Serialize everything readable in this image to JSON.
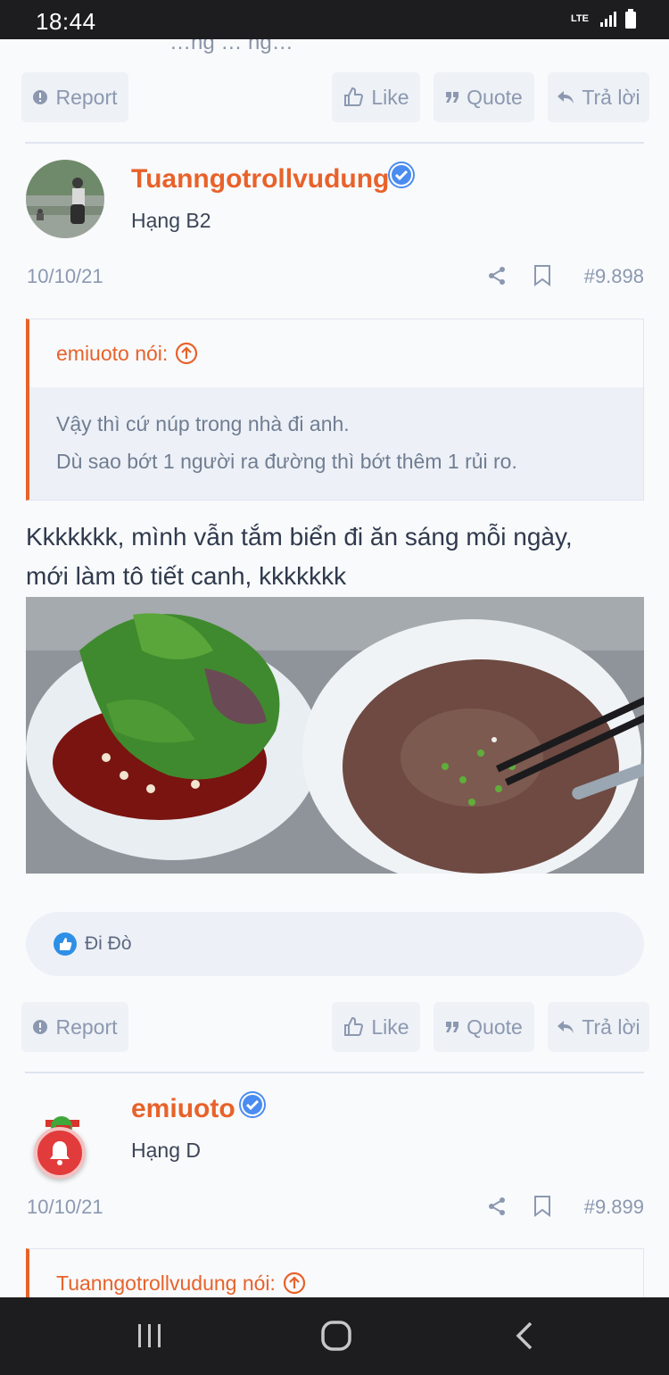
{
  "status_bar": {
    "time": "18:44",
    "network": "LTE"
  },
  "top_cut_text": "…ng … ng…",
  "action_labels": {
    "report": "Report",
    "like": "Like",
    "quote": "Quote",
    "reply": "Trả lời"
  },
  "posts": [
    {
      "username": "Tuanngotrollvudung",
      "rank": "Hạng B2",
      "date": "10/10/21",
      "post_number": "#9.898",
      "quote": {
        "author_label": "emiuoto nói:",
        "lines": [
          "Vậy thì cứ núp trong nhà đi anh.",
          "Dù sao bớt 1 người ra đường thì bớt thêm 1 rủi ro."
        ]
      },
      "text_lines": [
        "Kkkkkkk, mình vẫn tắm biển đi ăn sáng mỗi ngày,",
        "mới làm tô tiết canh, kkkkkkk"
      ],
      "reaction": {
        "icon": "like-icon",
        "user": "Đi Đò"
      }
    },
    {
      "username": "emiuoto",
      "rank": "Hạng D",
      "date": "10/10/21",
      "post_number": "#9.899",
      "quote": {
        "author_label": "Tuanngotrollvudung nói:"
      }
    }
  ],
  "colors": {
    "accent": "#e8622a",
    "verified": "#4a8cf0",
    "muted": "#8b98b0"
  }
}
